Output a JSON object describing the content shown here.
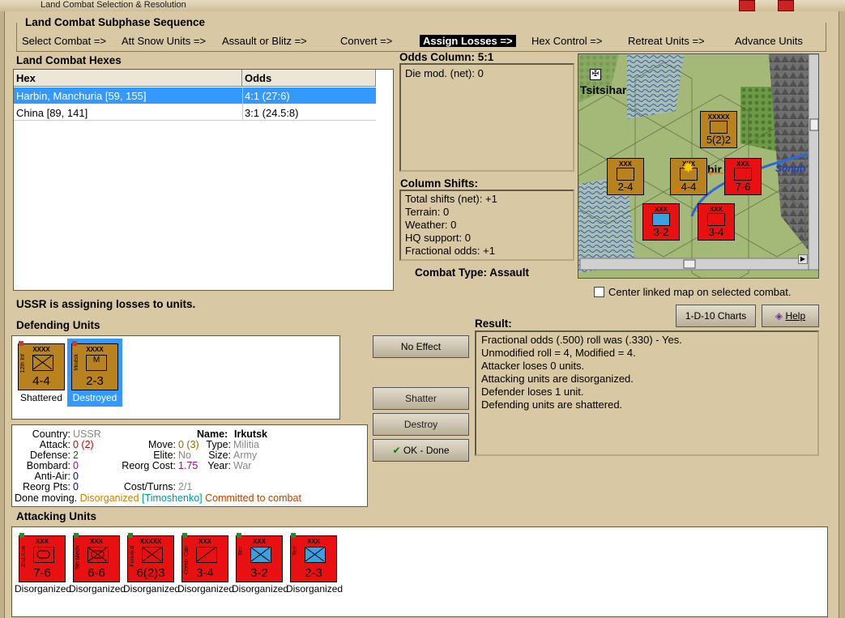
{
  "window": {
    "title": "Land Combat Selection & Resolution"
  },
  "sequence": {
    "title": "Land Combat Subphase Sequence",
    "steps": [
      "Select Combat =>",
      "Att Snow Units =>",
      "Assault or Blitz =>",
      "Convert =>",
      "Assign Losses =>",
      "Hex Control =>",
      "Retreat Units =>",
      "Advance Units"
    ],
    "active_index": 4
  },
  "hexes": {
    "title": "Land Combat Hexes",
    "columns": [
      "Hex",
      "Odds"
    ],
    "rows": [
      {
        "hex": "Harbin, Manchuria [59, 155]",
        "odds": "4:1 (27:6)",
        "selected": true
      },
      {
        "hex": "China [89, 141]",
        "odds": "3:1 (24.5:8)",
        "selected": false
      }
    ]
  },
  "odds": {
    "title": "Odds Column: 5:1",
    "die_mod": "Die mod. (net): 0"
  },
  "shifts": {
    "title": "Column Shifts:",
    "lines": [
      "Total shifts (net): +1",
      "Terrain: 0",
      "Weather: 0",
      "HQ support: 0",
      "Fractional odds: +1"
    ]
  },
  "combat_type": "Combat Type:  Assault",
  "map": {
    "city": "Tsitsihar",
    "river": "Songh",
    "city2": "bir"
  },
  "center_map_label": "Center linked map on selected combat.",
  "status_msg": "USSR is assigning losses to units.",
  "defending": {
    "title": "Defending Units",
    "units": [
      {
        "name": "12th Inf",
        "size": "XXXX",
        "str": "4-4",
        "caption": "Shattered",
        "color": "tan",
        "selected": false
      },
      {
        "name": "Irkutsk",
        "size": "XXXX",
        "str": "2-3",
        "caption": "Destroyed",
        "color": "tan",
        "selected": true,
        "sym": "M"
      }
    ]
  },
  "unit_info": {
    "country_lbl": "Country:",
    "country": "USSR",
    "attack_lbl": "Attack:",
    "attack": "0 (2)",
    "defense_lbl": "Defense:",
    "defense": "2",
    "bombard_lbl": "Bombard:",
    "bombard": "0",
    "antiair_lbl": "Anti-Air:",
    "antiair": "0",
    "reorgpts_lbl": "Reorg Pts:",
    "reorgpts": "0",
    "name_lbl": "Name:",
    "name": "Irkutsk",
    "move_lbl": "Move:",
    "move": "0 (3)",
    "elite_lbl": "Elite:",
    "elite": "No",
    "reorgcost_lbl": "Reorg Cost:",
    "reorgcost": "1.75",
    "costturns_lbl": "Cost/Turns:",
    "costturns": "2/1",
    "type_lbl": "Type:",
    "type": "Militia",
    "size_lbl": "Size:",
    "size": "Army",
    "year_lbl": "Year:",
    "year": "War",
    "status_done": "Done moving.",
    "status_disorg": "Disorganized",
    "status_hq": "[Timoshenko]",
    "status_comm": "Committed to combat"
  },
  "buttons": {
    "no_effect": "No Effect",
    "shatter": "Shatter",
    "destroy": "Destroy",
    "ok_done": "OK - Done",
    "charts": "1-D-10 Charts",
    "help": "Help"
  },
  "result": {
    "title": "Result:",
    "lines": [
      "Fractional odds (.500) roll was (.330)  - Yes.",
      "Unmodified roll = 4, Modified = 4.",
      "Attacker loses 0 units.",
      "Attacking units are disorganized.",
      "Defender loses 1 unit.",
      "Defending units are shattered."
    ]
  },
  "attacking": {
    "title": "Attacking Units",
    "units": [
      {
        "name": "2nd Arm",
        "size": "XXX",
        "str": "7-6",
        "caption": "Disorganized",
        "sym": "arm"
      },
      {
        "name": "5th Mech",
        "size": "XXX",
        "str": "6-6",
        "caption": "Disorganized",
        "sym": "mech"
      },
      {
        "name": "Forward",
        "size": "XXXXX",
        "str": "6(2)3",
        "caption": "Disorganized",
        "sym": "inf"
      },
      {
        "name": "Comb. Cav",
        "size": "XXX",
        "str": "3-4",
        "caption": "Disorganized",
        "sym": "cav"
      },
      {
        "name": "Terr",
        "size": "XXX",
        "str": "3-2",
        "caption": "Disorganized",
        "sym": "terr"
      },
      {
        "name": "Terr",
        "size": "XXX",
        "str": "2-3",
        "caption": "Disorganized",
        "sym": "terr"
      }
    ]
  },
  "map_units": [
    {
      "str": "5(2)2",
      "size": "XXXXX",
      "color": "tan"
    },
    {
      "str": "2-4",
      "size": "XXX",
      "color": "tan"
    },
    {
      "str": "4-4",
      "size": "XXX",
      "color": "tan"
    },
    {
      "str": "7-6",
      "size": "XXX",
      "color": "red"
    },
    {
      "str": "3-2",
      "size": "XXX",
      "color": "red"
    },
    {
      "str": "3-4",
      "size": "XXX",
      "color": "red"
    }
  ],
  "colors": {
    "disorganized": "#d08000",
    "hq": "#009a9a",
    "committed": "#c04000",
    "gray": "#888888",
    "red": "#cc0000",
    "green": "#007000",
    "purple": "#a000a0",
    "blue": "#0000cc"
  }
}
